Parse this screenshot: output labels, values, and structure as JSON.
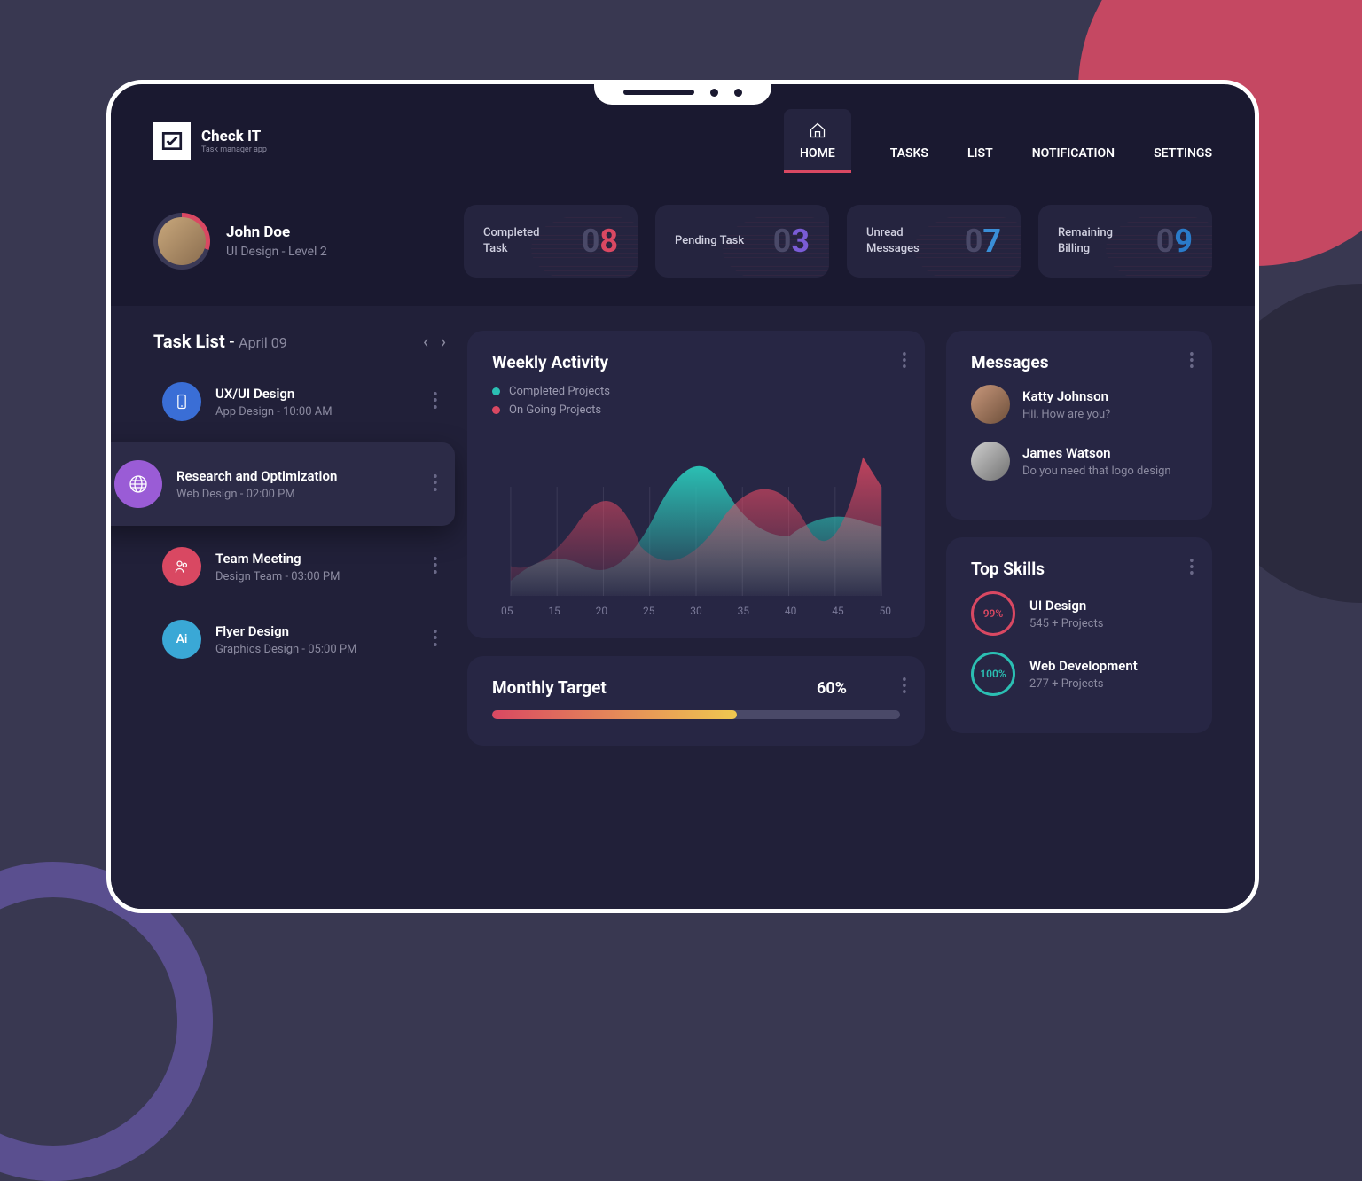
{
  "brand": {
    "name": "Check IT",
    "tagline": "Task manager app"
  },
  "nav": {
    "home": "HOME",
    "tasks": "TASKS",
    "list": "LIST",
    "notification": "NOTIFICATION",
    "settings": "SETTINGS"
  },
  "profile": {
    "name": "John Doe",
    "role": "UI Design - Level 2"
  },
  "stats": [
    {
      "label": "Completed Task",
      "value": "8",
      "color": "#d94862"
    },
    {
      "label": "Pending Task",
      "value": "3",
      "color": "#7a5cd6"
    },
    {
      "label": "Unread Messages",
      "value": "7",
      "color": "#3a8ed6"
    },
    {
      "label": "Remaining Billing",
      "value": "9",
      "color": "#2a7bc9"
    }
  ],
  "task_list": {
    "title": "Task List",
    "date": "April 09",
    "items": [
      {
        "name": "UX/UI Design",
        "sub": "App Design - 10:00 AM",
        "icon": "phone",
        "icon_bg": "#3a6ed6"
      },
      {
        "name": "Research and Optimization",
        "sub": "Web Design - 02:00 PM",
        "icon": "globe",
        "icon_bg": "#9a5cd6",
        "active": true
      },
      {
        "name": "Team Meeting",
        "sub": "Design Team - 03:00 PM",
        "icon": "team",
        "icon_bg": "#d94862"
      },
      {
        "name": "Flyer Design",
        "sub": "Graphics Design - 05:00 PM",
        "icon": "ai",
        "icon_bg": "#3aa8d6",
        "icon_text": "Ai"
      }
    ]
  },
  "weekly": {
    "title": "Weekly Activity",
    "legend": [
      {
        "label": "Completed Projects",
        "color": "#2bbfb3"
      },
      {
        "label": "On Going Projects",
        "color": "#d94862"
      }
    ]
  },
  "chart_data": {
    "type": "area",
    "title": "Weekly Activity",
    "x": [
      5,
      15,
      20,
      25,
      30,
      35,
      40,
      45,
      50
    ],
    "ylim": [
      0,
      100
    ],
    "series": [
      {
        "name": "Completed Projects",
        "color": "#2bbfb3",
        "values": [
          10,
          30,
          20,
          40,
          90,
          50,
          35,
          55,
          65
        ]
      },
      {
        "name": "On Going Projects",
        "color": "#d94862",
        "values": [
          20,
          15,
          60,
          30,
          25,
          60,
          40,
          95,
          70
        ]
      }
    ]
  },
  "target": {
    "title": "Monthly Target",
    "percent": "60%",
    "value": 60
  },
  "messages": {
    "title": "Messages",
    "items": [
      {
        "name": "Katty Johnson",
        "text": "Hii, How are you?",
        "avatar_bg": "linear-gradient(135deg,#c9987c,#6d4f3a)"
      },
      {
        "name": "James Watson",
        "text": "Do you need that logo design",
        "avatar_bg": "linear-gradient(135deg,#d0d0d0,#707070)"
      }
    ]
  },
  "skills": {
    "title": "Top Skills",
    "items": [
      {
        "name": "UI Design",
        "sub": "545 + Projects",
        "pct": "99%",
        "color": "#d94862"
      },
      {
        "name": "Web Development",
        "sub": "277 + Projects",
        "pct": "100%",
        "color": "#2bbfb3"
      }
    ]
  }
}
